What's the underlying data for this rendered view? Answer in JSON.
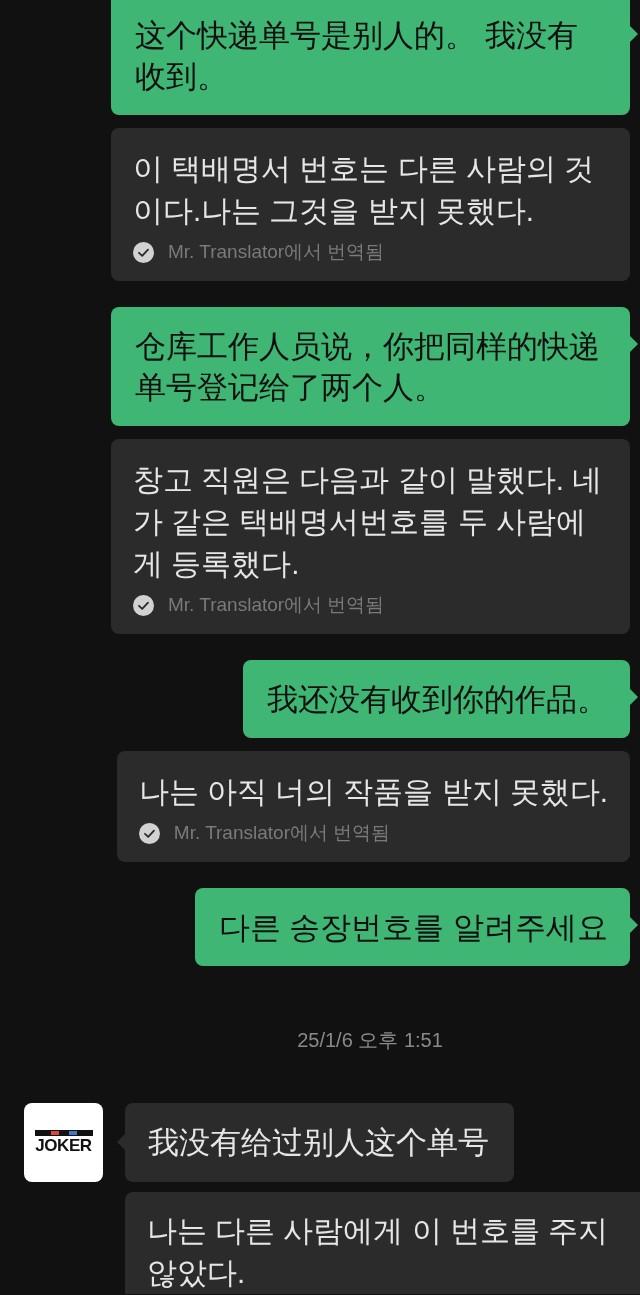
{
  "messages": [
    {
      "kind": "sent",
      "text": "这个快递单号是别人的。 我没有收到。",
      "translation": {
        "text": "이 택배명서 번호는 다른 사람의 것이다.나는 그것을 받지 못했다.",
        "note": "Mr. Translator에서 번역됨"
      }
    },
    {
      "kind": "sent",
      "text": "仓库工作人员说，你把同样的快递单号登记给了两个人。",
      "translation": {
        "text": "창고 직원은 다음과 같이 말했다. 네가 같은 택배명서번호를 두 사람에게 등록했다.",
        "note": "Mr. Translator에서 번역됨"
      }
    },
    {
      "kind": "sent",
      "text": "我还没有收到你的作品。",
      "translation": {
        "text": "나는 아직 너의 작품을 받지 못했다.",
        "note": "Mr. Translator에서 번역됨"
      }
    },
    {
      "kind": "sent",
      "text": "다른 송장번호를 알려주세요"
    },
    {
      "kind": "timestamp",
      "text": "25/1/6 오후 1:51"
    },
    {
      "kind": "received",
      "avatar": {
        "text": "JOKER"
      },
      "text": "我没有给过别人这个单号",
      "translation": {
        "text": "나는 다른 사람에게 이 번호를 주지 않았다."
      }
    }
  ]
}
